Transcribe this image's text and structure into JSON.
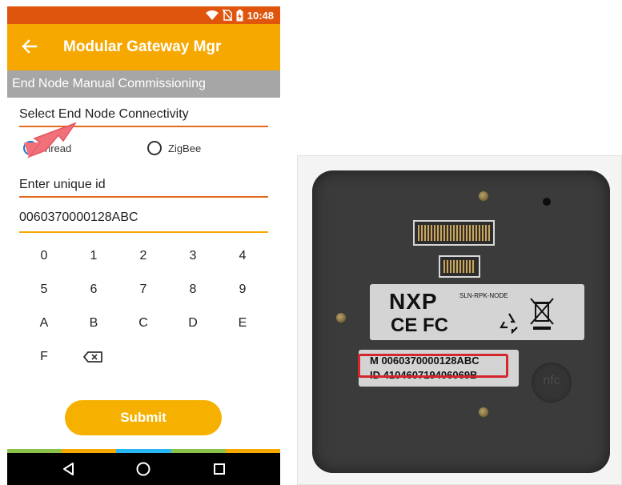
{
  "status_bar": {
    "time": "10:48",
    "icons": [
      "wifi-icon",
      "no-sim-icon",
      "battery-charging-icon"
    ],
    "color": "#e0550e"
  },
  "app_bar": {
    "title": "Modular Gateway Mgr",
    "back_icon": "back-arrow-icon",
    "color": "#f6a800"
  },
  "section": {
    "title": "End Node Manual Commissioning"
  },
  "connectivity": {
    "label": "Select End Node Connectivity",
    "options": [
      {
        "label": "Thread",
        "selected": true
      },
      {
        "label": "ZigBee",
        "selected": false
      }
    ],
    "visible_option_text": "hread"
  },
  "unique_id": {
    "label": "Enter unique id",
    "value": "0060370000128ABC"
  },
  "keypad": {
    "keys": [
      "0",
      "1",
      "2",
      "3",
      "4",
      "5",
      "6",
      "7",
      "8",
      "9",
      "A",
      "B",
      "C",
      "D",
      "E",
      "F"
    ],
    "backspace_icon": "backspace-icon"
  },
  "submit": {
    "label": "Submit"
  },
  "nav_bar": {
    "icons": [
      "back-triangle-icon",
      "home-circle-icon",
      "recents-square-icon"
    ]
  },
  "device_photo": {
    "brand": "NXP",
    "model": "SLN-RPK-NODE",
    "certifications": "CE FC",
    "id_m_line": "M 0060370000128ABC",
    "id_line": "ID 410460719406069B",
    "nfc_label": "nfc",
    "highlight_color": "#d3262d"
  },
  "annotation": {
    "pink_arrow_color": "#f1707a"
  }
}
